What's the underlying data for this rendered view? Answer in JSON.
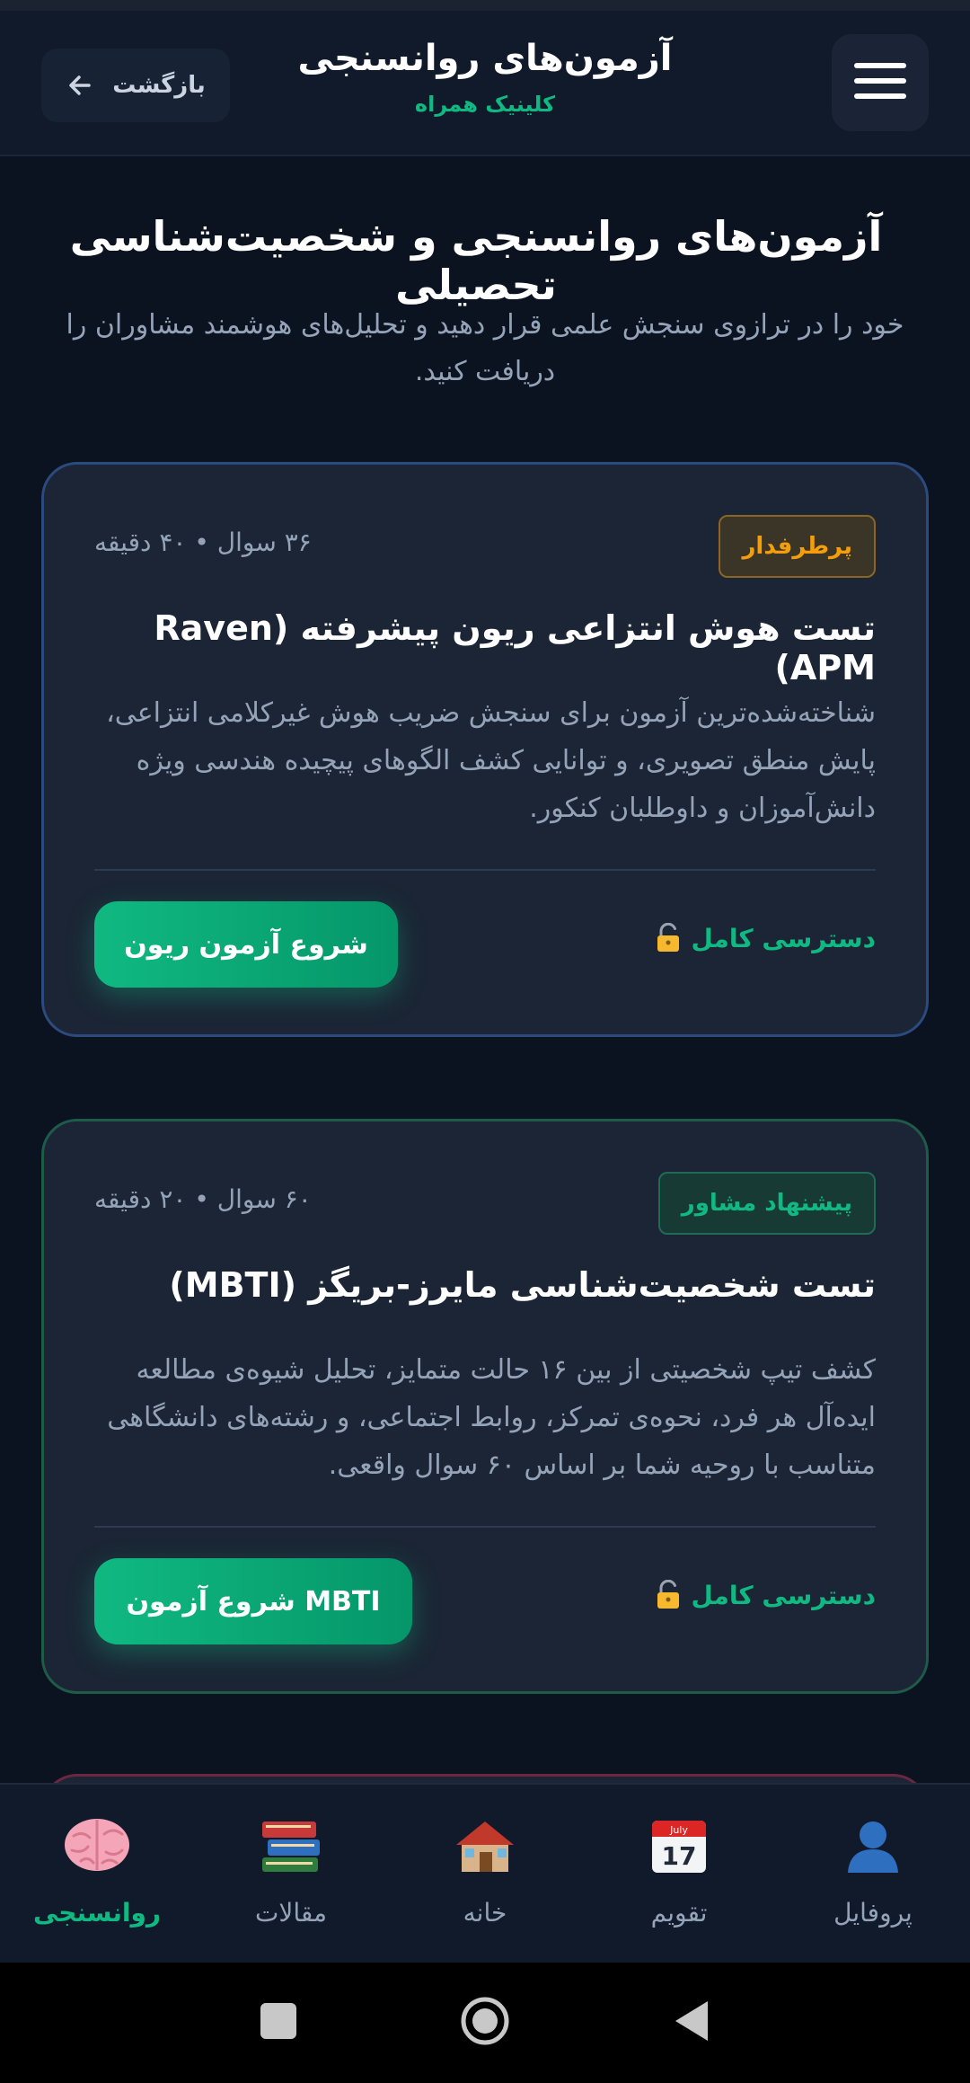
{
  "header": {
    "back_label": "بازگشت",
    "title": "آزمون‌های روانسنجی",
    "subtitle": "کلینیک همراه"
  },
  "page": {
    "title": "آزمون‌های روانسنجی و شخصیت‌شناسی تحصیلی",
    "description": "خود را در ترازوی سنجش علمی قرار دهید و تحلیل‌های هوشمند مشاوران را دریافت کنید."
  },
  "cards": [
    {
      "badge": "پرطرفدار",
      "meta": "۳۶ سوال • ۴۰ دقیقه",
      "title": "تست هوش انتزاعی ریون پیشرفته (Raven APM)",
      "description": "شناخته‌شده‌ترین آزمون برای سنجش ضریب هوش غیرکلامی انتزاعی، پایش منطق تصویری، و توانایی کشف الگوهای پیچیده هندسی ویژه دانش‌آموزان و داوطلبان کنکور.",
      "access": "دسترسی کامل",
      "button": "شروع آزمون ریون"
    },
    {
      "badge": "پیشنهاد مشاور",
      "meta": "۶۰ سوال • ۲۰ دقیقه",
      "title": "تست شخصیت‌شناسی مایرز-بریگز (MBTI)",
      "description": "کشف تیپ شخصیتی از بین ۱۶ حالت متمایز، تحلیل شیوه‌ی مطالعه ایده‌آل هر فرد، نحوه‌ی تمرکز، روابط اجتماعی، و رشته‌های دانشگاهی متناسب با روحیه شما بر اساس ۶۰ سوال واقعی.",
      "access": "دسترسی کامل",
      "button": "شروع آزمون MBTI"
    }
  ],
  "nav": [
    {
      "label": "روانسنجی",
      "icon": "brain-icon",
      "active": true
    },
    {
      "label": "مقالات",
      "icon": "books-icon"
    },
    {
      "label": "خانه",
      "icon": "house-icon"
    },
    {
      "label": "تقویم",
      "icon": "calendar-icon"
    },
    {
      "label": "پروفایل",
      "icon": "user-icon"
    }
  ],
  "calendar_icon": {
    "month": "July",
    "day": "17"
  },
  "colors": {
    "accent": "#10b981",
    "background": "#0b1220",
    "card": "#1b2535",
    "badge_popular": "#f59e0b"
  }
}
